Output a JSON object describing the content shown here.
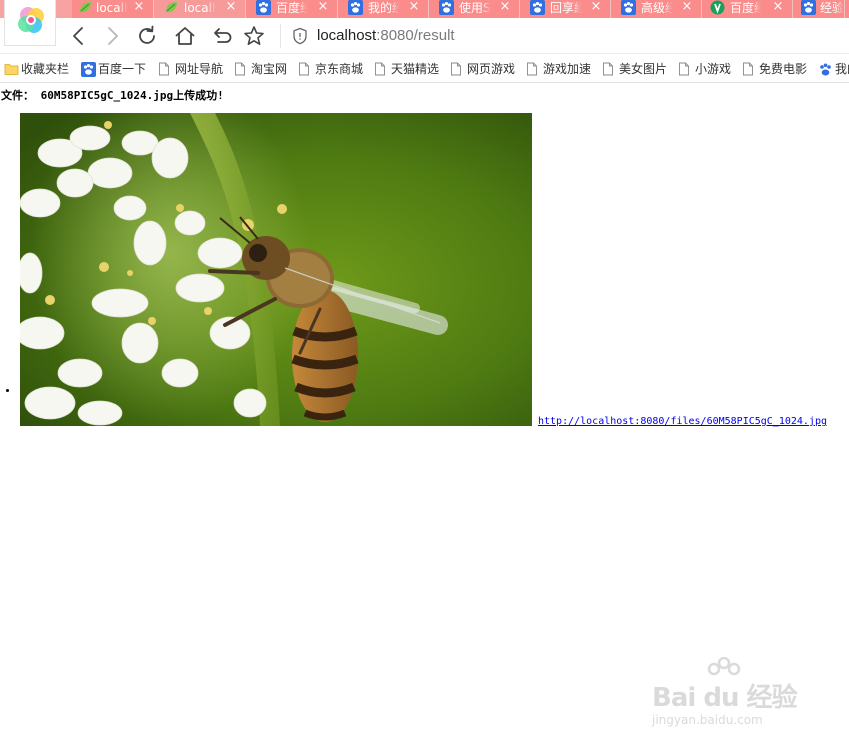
{
  "tabs": [
    {
      "title": "localh",
      "icon": "leaf-icon"
    },
    {
      "title": "localh",
      "icon": "leaf-icon"
    },
    {
      "title": "百度经",
      "icon": "baidu-paw-icon"
    },
    {
      "title": "我的经",
      "icon": "baidu-paw-icon"
    },
    {
      "title": "使用S",
      "icon": "baidu-paw-icon"
    },
    {
      "title": "回享經",
      "icon": "baidu-paw-icon"
    },
    {
      "title": "高级经",
      "icon": "baidu-paw-icon"
    },
    {
      "title": "百度经",
      "icon": "green-shield-icon"
    },
    {
      "title": "经验",
      "icon": "baidu-paw-icon"
    }
  ],
  "tab_close_glyph": "×",
  "address": {
    "host": "localhost",
    "rest": ":8080/result"
  },
  "bookmarks": [
    {
      "label": "收藏夹栏",
      "icon": "folder-icon"
    },
    {
      "label": "百度一下",
      "icon": "baidu-paw-icon"
    },
    {
      "label": "网址导航",
      "icon": "page-icon"
    },
    {
      "label": "淘宝网",
      "icon": "page-icon"
    },
    {
      "label": "京东商城",
      "icon": "page-icon"
    },
    {
      "label": "天猫精选",
      "icon": "page-icon"
    },
    {
      "label": "网页游戏",
      "icon": "page-icon"
    },
    {
      "label": "游戏加速",
      "icon": "page-icon"
    },
    {
      "label": "美女图片",
      "icon": "page-icon"
    },
    {
      "label": "小游戏",
      "icon": "page-icon"
    },
    {
      "label": "免费电影",
      "icon": "page-icon"
    },
    {
      "label": "我的",
      "icon": "baidu-paw-icon"
    }
  ],
  "page": {
    "message": "文件： 60M58PIC5gC_1024.jpg上传成功!",
    "file_link": "http://localhost:8080/files/60M58PIC5gC_1024.jpg"
  },
  "watermark": {
    "text": "Bai du 经验",
    "sub": "jingyan.baidu.com"
  },
  "colors": {
    "tab_strip": "#f7a3a3",
    "tab_active": "#fa8c8c",
    "link": "#0000ee"
  }
}
